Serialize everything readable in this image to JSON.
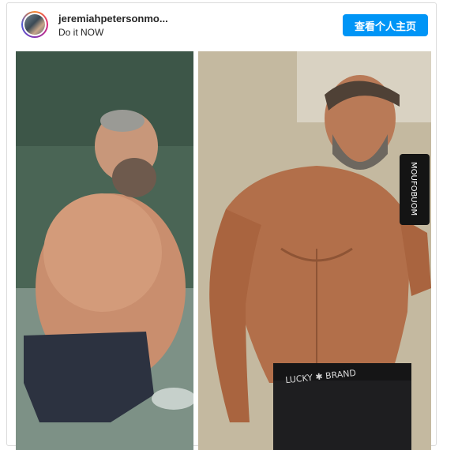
{
  "post": {
    "username": "jeremiahpetersonmo...",
    "caption": "Do it NOW",
    "view_profile_button": "查看个人主页"
  },
  "photo": {
    "left_phone_text": "",
    "shorts_brand": "LUCKY ✱ BRAND",
    "phone_case_text": "MOUFOBUOM"
  }
}
